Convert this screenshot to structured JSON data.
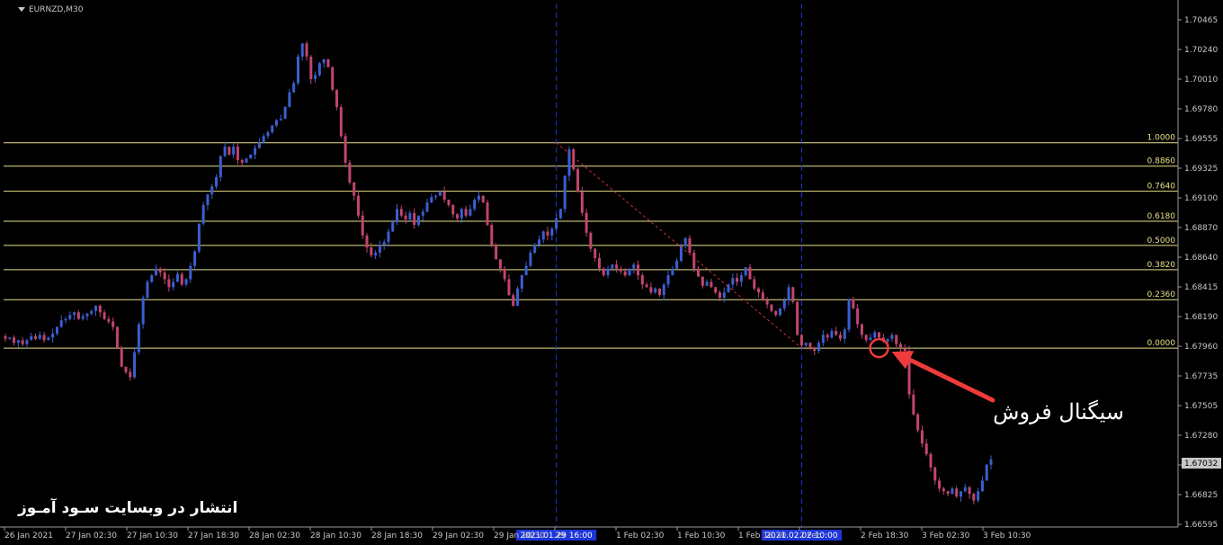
{
  "window": {
    "title": "EURNZD,M30"
  },
  "colors": {
    "background": "#000000",
    "bull": "#3a5fd0",
    "bear": "#c2456e",
    "fib": "#e8e08a",
    "vline": "#1e35d8",
    "arrow": "#ee3b3b",
    "axis_text": "#c8c8c8",
    "axis_line": "#9a9a9a"
  },
  "icons": {
    "signal_marker": "circle-marker-icon",
    "signal_arrow": "arrow-icon",
    "title_menu": "triangle-down-icon"
  },
  "chart_data": {
    "type": "candlestick",
    "symbol": "EURNZD",
    "timeframe": "M30",
    "ylim": [
      1.6655,
      1.705
    ],
    "y_ticks": [
      "1.70465",
      "1.70240",
      "1.70010",
      "1.69780",
      "1.69555",
      "1.69325",
      "1.69100",
      "1.68870",
      "1.68640",
      "1.68415",
      "1.68190",
      "1.67960",
      "1.67735",
      "1.67505",
      "1.67280",
      "1.67050",
      "1.66825",
      "1.66595"
    ],
    "current_price": "1.67032",
    "x_ticks": [
      "26 Jan 2021",
      "27 Jan 02:30",
      "27 Jan 10:30",
      "27 Jan 18:30",
      "28 Jan 02:30",
      "28 Jan 10:30",
      "28 Jan 18:30",
      "29 Jan 02:30",
      "29 Jan 10:30",
      "29",
      "1 Feb 02:30",
      "1 Feb 10:30",
      "1 Feb 18:30",
      "2 Feb",
      "2 Feb 18:30",
      "3 Feb 02:30",
      "3 Feb 10:30"
    ],
    "vertical_line_labels": [
      "2021.01.29 16:00",
      "2021.02.02 10:00"
    ],
    "fibonacci": {
      "level_labels": [
        "1.0000",
        "0.8860",
        "0.7640",
        "0.6180",
        "0.5000",
        "0.3820",
        "0.2360",
        "0.0000"
      ],
      "level_ratios": [
        1.0,
        0.886,
        0.764,
        0.618,
        0.5,
        0.382,
        0.236,
        0.0
      ],
      "price_at_1": 1.6945,
      "price_at_0": 1.679
    },
    "candles": [
      1.6797,
      1.6798,
      1.6794,
      1.6796,
      1.6793,
      1.6796,
      1.6799,
      1.6797,
      1.68,
      1.6796,
      1.6798,
      1.6801,
      1.6806,
      1.6811,
      1.6812,
      1.6815,
      1.6817,
      1.6812,
      1.6814,
      1.6816,
      1.6818,
      1.6822,
      1.6817,
      1.6812,
      1.681,
      1.6806,
      1.679,
      1.6776,
      1.6772,
      1.6768,
      1.6787,
      1.6808,
      1.6828,
      1.684,
      1.6845,
      1.685,
      1.6847,
      1.6842,
      1.6836,
      1.684,
      1.6846,
      1.6838,
      1.6842,
      1.6852,
      1.6863,
      1.6884,
      1.6898,
      1.6906,
      1.6912,
      1.6919,
      1.6935,
      1.6942,
      1.6936,
      1.6942,
      1.6932,
      1.693,
      1.6933,
      1.6936,
      1.6941,
      1.6945,
      1.695,
      1.6953,
      1.6958,
      1.6962,
      1.6963,
      1.6972,
      1.6983,
      1.699,
      1.701,
      1.702,
      1.701,
      1.6993,
      1.6996,
      1.7005,
      1.7008,
      1.7002,
      1.6985,
      1.6972,
      1.695,
      1.693,
      1.6915,
      1.6905,
      1.689,
      1.6875,
      1.6866,
      1.686,
      1.6862,
      1.6868,
      1.687,
      1.6878,
      1.6885,
      1.6895,
      1.689,
      1.6887,
      1.6892,
      1.6883,
      1.689,
      1.6893,
      1.69,
      1.6904,
      1.6905,
      1.6908,
      1.6902,
      1.6898,
      1.6891,
      1.6888,
      1.6895,
      1.689,
      1.6895,
      1.6902,
      1.6905,
      1.69,
      1.6883,
      1.6868,
      1.6857,
      1.685,
      1.6842,
      1.683,
      1.6822,
      1.6835,
      1.6845,
      1.6852,
      1.6862,
      1.6868,
      1.6872,
      1.6878,
      1.6875,
      1.688,
      1.6888,
      1.6895,
      1.692,
      1.694,
      1.6925,
      1.6908,
      1.6892,
      1.6877,
      1.6865,
      1.6858,
      1.685,
      1.6845,
      1.685,
      1.6853,
      1.685,
      1.6848,
      1.6845,
      1.685,
      1.6853,
      1.6845,
      1.6838,
      1.6836,
      1.6832,
      1.6835,
      1.683,
      1.6838,
      1.6845,
      1.685,
      1.6856,
      1.6867,
      1.6873,
      1.6862,
      1.685,
      1.6844,
      1.6837,
      1.684,
      1.6836,
      1.6832,
      1.6828,
      1.6832,
      1.6838,
      1.6843,
      1.684,
      1.6845,
      1.6851,
      1.6842,
      1.6835,
      1.6832,
      1.6826,
      1.6823,
      1.6818,
      1.6815,
      1.682,
      1.6826,
      1.6836,
      1.6825,
      1.68,
      1.6792,
      1.6794,
      1.679,
      1.6788,
      1.6794,
      1.68,
      1.6798,
      1.6803,
      1.68,
      1.6797,
      1.6804,
      1.6827,
      1.682,
      1.6808,
      1.68,
      1.6796,
      1.6798,
      1.6802,
      1.6798,
      1.6795,
      1.6797,
      1.68,
      1.6793,
      1.679,
      1.6788,
      1.6755,
      1.674,
      1.6728,
      1.6718,
      1.671,
      1.67,
      1.669,
      1.6684,
      1.6682,
      1.668,
      1.6684,
      1.6678,
      1.6682,
      1.6685,
      1.668,
      1.6675,
      1.6682,
      1.669,
      1.6702,
      1.6706
    ],
    "signal_candle_index": 203,
    "vertical_line_indices": [
      128,
      185
    ],
    "annotation": "سیگنال فروش",
    "watermark": "انتشار در وبسایت سـود آمـوز"
  }
}
